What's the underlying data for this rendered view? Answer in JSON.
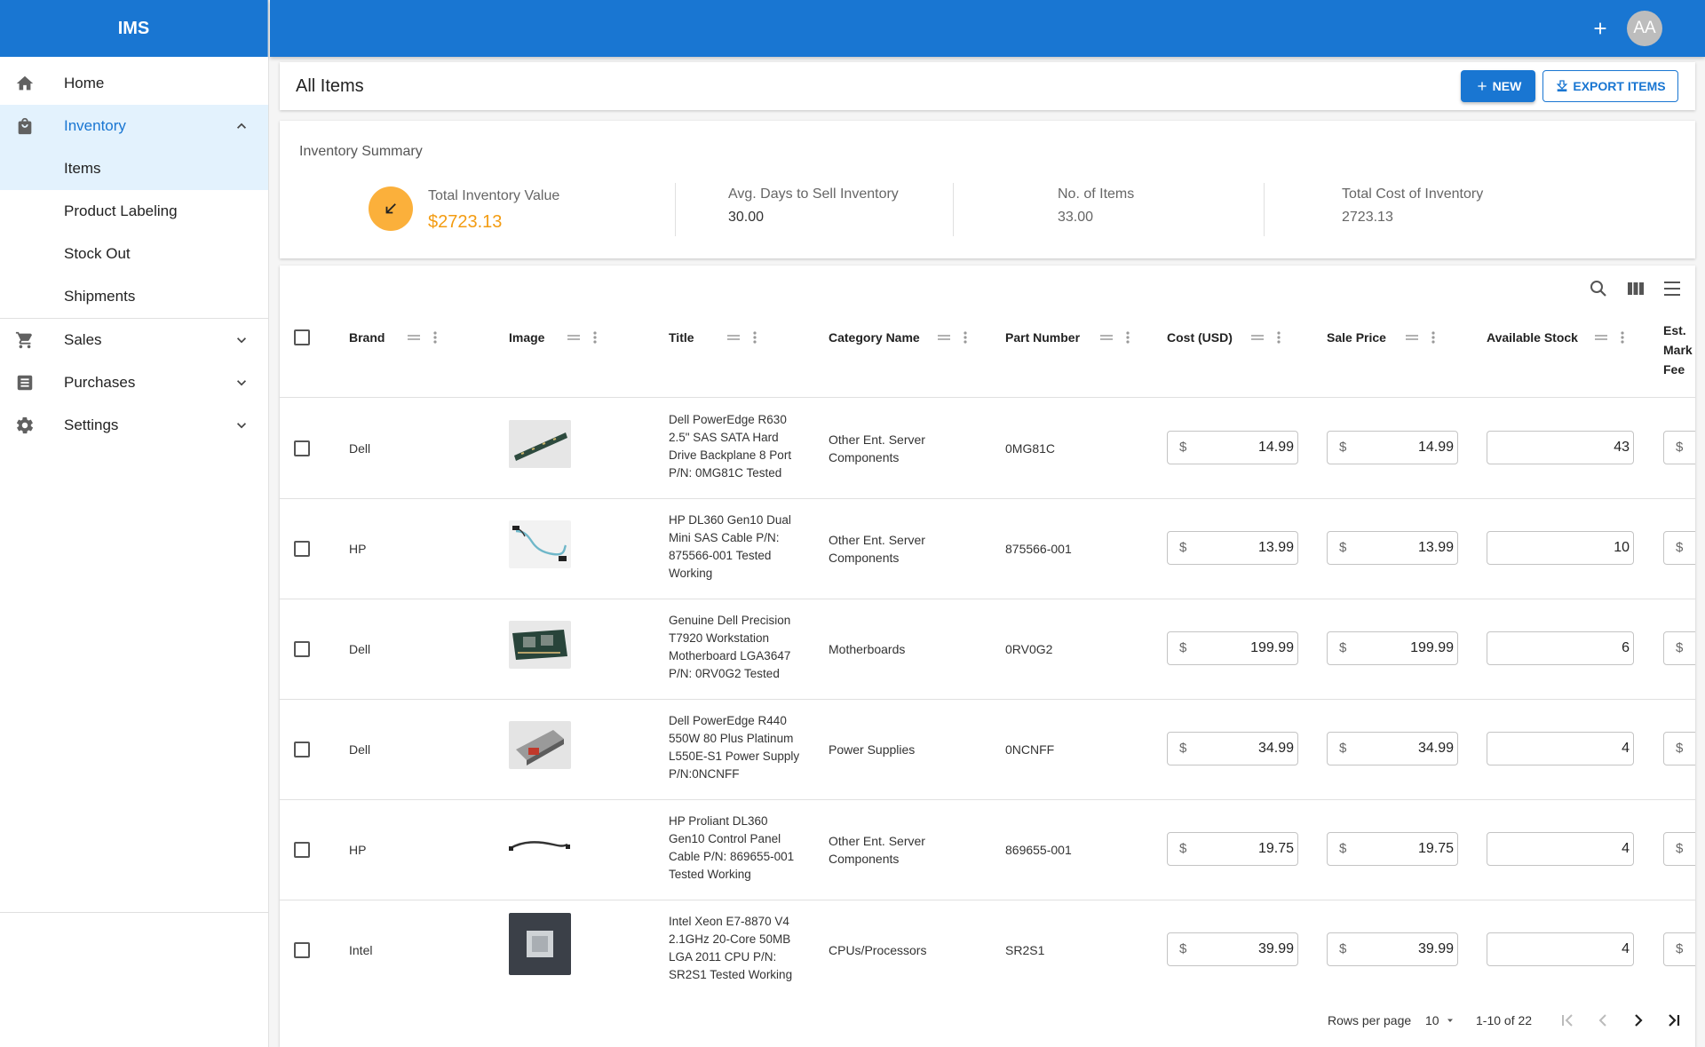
{
  "app": {
    "title": "IMS",
    "avatar_initials": "AA"
  },
  "sidebar": {
    "home": "Home",
    "inventory": "Inventory",
    "inventory_items": [
      "Items",
      "Product Labeling",
      "Stock Out",
      "Shipments"
    ],
    "sales": "Sales",
    "purchases": "Purchases",
    "settings": "Settings"
  },
  "header": {
    "title": "All Items",
    "new_label": "NEW",
    "export_label": "EXPORT ITEMS"
  },
  "summary": {
    "title": "Inventory Summary",
    "total_value_label": "Total Inventory Value",
    "total_value": "$2723.13",
    "avg_days_label": "Avg. Days to Sell Inventory",
    "avg_days": "30.00",
    "num_items_label": "No. of Items",
    "num_items": "33.00",
    "total_cost_label": "Total Cost of Inventory",
    "total_cost": "2723.13"
  },
  "table": {
    "columns": [
      "Brand",
      "Image",
      "Title",
      "Category Name",
      "Part Number",
      "Cost (USD)",
      "Sale Price",
      "Available Stock",
      "Est. Mark Fee"
    ],
    "currency_symbol": "$",
    "rows": [
      {
        "brand": "Dell",
        "title": "Dell PowerEdge R630 2.5\" SAS SATA Hard Drive Backplane 8 Port P/N: 0MG81C Tested",
        "category": "Other Ent. Server Components",
        "part": "0MG81C",
        "cost": "14.99",
        "sale": "14.99",
        "stock": "43"
      },
      {
        "brand": "HP",
        "title": "HP DL360 Gen10 Dual Mini SAS Cable P/N: 875566-001 Tested Working",
        "category": "Other Ent. Server Components",
        "part": "875566-001",
        "cost": "13.99",
        "sale": "13.99",
        "stock": "10"
      },
      {
        "brand": "Dell",
        "title": "Genuine Dell Precision T7920 Workstation Motherboard LGA3647 P/N: 0RV0G2 Tested",
        "category": "Motherboards",
        "part": "0RV0G2",
        "cost": "199.99",
        "sale": "199.99",
        "stock": "6"
      },
      {
        "brand": "Dell",
        "title": "Dell PowerEdge R440 550W 80 Plus Platinum L550E-S1 Power Supply P/N:0NCNFF",
        "category": "Power Supplies",
        "part": "0NCNFF",
        "cost": "34.99",
        "sale": "34.99",
        "stock": "4"
      },
      {
        "brand": "HP",
        "title": "HP Proliant DL360 Gen10 Control Panel Cable P/N: 869655-001 Tested Working",
        "category": "Other Ent. Server Components",
        "part": "869655-001",
        "cost": "19.75",
        "sale": "19.75",
        "stock": "4"
      },
      {
        "brand": "Intel",
        "title": "Intel Xeon E7-8870 V4 2.1GHz 20-Core 50MB LGA 2011 CPU P/N: SR2S1 Tested Working",
        "category": "CPUs/Processors",
        "part": "SR2S1",
        "cost": "39.99",
        "sale": "39.99",
        "stock": "4"
      }
    ]
  },
  "pagination": {
    "rows_per_page_label": "Rows per page",
    "rows_per_page": "10",
    "range": "1-10 of 22"
  },
  "colors": {
    "primary": "#1976d2",
    "accent": "#fbb03b",
    "value_orange": "#f39c12"
  }
}
